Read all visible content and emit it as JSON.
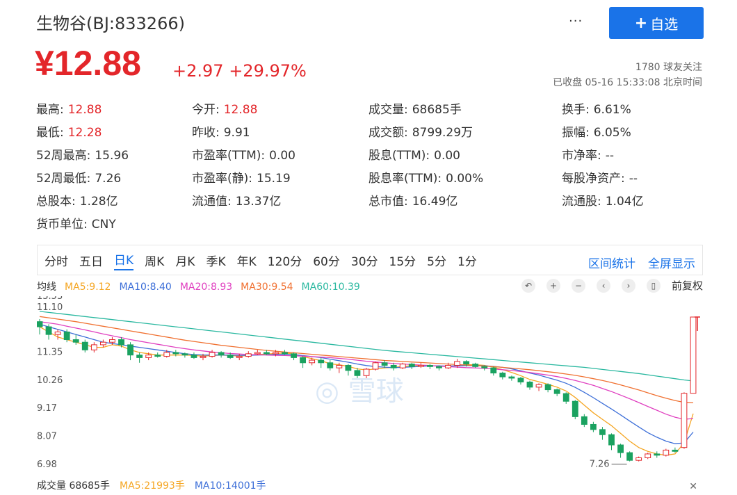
{
  "header": {
    "title": "生物谷(BJ:833266)",
    "more_label": "···",
    "add_label": "自选",
    "add_icon": "plus-icon"
  },
  "price": {
    "current": "¥12.88",
    "change": "+2.97",
    "change_pct": "+29.97%",
    "followers": "1780 球友关注",
    "status": "已收盘 05-16 15:33:08 北京时间"
  },
  "quote": [
    [
      {
        "label": "最高:",
        "value": "12.88",
        "tone": "red"
      },
      {
        "label": "今开:",
        "value": "12.88",
        "tone": "red"
      },
      {
        "label": "成交量:",
        "value": "68685手",
        "tone": ""
      },
      {
        "label": "换手:",
        "value": "6.61%",
        "tone": ""
      }
    ],
    [
      {
        "label": "最低:",
        "value": "12.28",
        "tone": "red"
      },
      {
        "label": "昨收:",
        "value": "9.91",
        "tone": ""
      },
      {
        "label": "成交额:",
        "value": "8799.29万",
        "tone": ""
      },
      {
        "label": "振幅:",
        "value": "6.05%",
        "tone": ""
      }
    ],
    [
      {
        "label": "52周最高:",
        "value": "15.96",
        "tone": ""
      },
      {
        "label": "市盈率(TTM):",
        "value": "0.00",
        "tone": ""
      },
      {
        "label": "股息(TTM):",
        "value": "0.00",
        "tone": ""
      },
      {
        "label": "市净率:",
        "value": "--",
        "tone": ""
      }
    ],
    [
      {
        "label": "52周最低:",
        "value": "7.26",
        "tone": ""
      },
      {
        "label": "市盈率(静):",
        "value": "15.19",
        "tone": ""
      },
      {
        "label": "股息率(TTM):",
        "value": "0.00%",
        "tone": ""
      },
      {
        "label": "每股净资产:",
        "value": "--",
        "tone": ""
      }
    ],
    [
      {
        "label": "总股本:",
        "value": "1.28亿",
        "tone": ""
      },
      {
        "label": "流通值:",
        "value": "13.37亿",
        "tone": ""
      },
      {
        "label": "总市值:",
        "value": "16.49亿",
        "tone": ""
      },
      {
        "label": "流通股:",
        "value": "1.04亿",
        "tone": ""
      }
    ],
    [
      {
        "label": "货币单位:",
        "value": "CNY",
        "tone": ""
      }
    ]
  ],
  "tabs": [
    "分时",
    "五日",
    "日K",
    "周K",
    "月K",
    "季K",
    "年K",
    "120分",
    "60分",
    "30分",
    "15分",
    "5分",
    "1分"
  ],
  "active_tab": "日K",
  "tools": [
    "区间统计",
    "全屏显示"
  ],
  "ma_legend": [
    {
      "text": "均线",
      "color": "#333333"
    },
    {
      "text": "MA5:9.12",
      "color": "#f5a623"
    },
    {
      "text": "MA10:8.40",
      "color": "#3d6fd8"
    },
    {
      "text": "MA20:8.93",
      "color": "#e040c0"
    },
    {
      "text": "MA30:9.54",
      "color": "#f07030"
    },
    {
      "text": "MA60:10.39",
      "color": "#2ab8a0"
    }
  ],
  "chart_controls": [
    "undo-icon",
    "zoom-in-icon",
    "zoom-out-icon",
    "left-icon",
    "right-icon",
    "candle-icon"
  ],
  "fq_label": "前复权",
  "volume_legend": [
    {
      "text": "成交量 68685手",
      "color": "#333333"
    },
    {
      "text": "MA5:21993手",
      "color": "#f5a623"
    },
    {
      "text": "MA10:14001手",
      "color": "#3d6fd8"
    }
  ],
  "watermark": "雪球",
  "colors": {
    "up": "#e3262a",
    "down": "#1aa260",
    "accent": "#1a73e8"
  },
  "chart_data": {
    "type": "candlestick",
    "y_ticks": [
      "13.53",
      "11.10",
      "11.35",
      "10.26",
      "9.17",
      "8.07",
      "6.98"
    ],
    "y_range": [
      6.98,
      13.53
    ],
    "min_label": "7.26",
    "candles": [
      [
        12.7,
        12.5,
        12.8,
        12.2
      ],
      [
        12.5,
        12.2,
        12.6,
        12.0
      ],
      [
        12.2,
        12.3,
        12.4,
        12.0
      ],
      [
        12.3,
        12.0,
        12.4,
        11.9
      ],
      [
        12.0,
        11.9,
        12.2,
        11.8
      ],
      [
        11.9,
        11.6,
        12.0,
        11.5
      ],
      [
        11.6,
        11.8,
        11.9,
        11.5
      ],
      [
        11.8,
        11.9,
        12.0,
        11.7
      ],
      [
        11.9,
        12.0,
        12.1,
        11.8
      ],
      [
        12.0,
        11.8,
        12.1,
        11.7
      ],
      [
        11.8,
        11.4,
        11.9,
        11.2
      ],
      [
        11.4,
        11.3,
        11.5,
        11.1
      ],
      [
        11.3,
        11.4,
        11.5,
        11.2
      ],
      [
        11.4,
        11.35,
        11.5,
        11.3
      ],
      [
        11.35,
        11.5,
        11.6,
        11.3
      ],
      [
        11.5,
        11.45,
        11.6,
        11.35
      ],
      [
        11.45,
        11.4,
        11.5,
        11.3
      ],
      [
        11.4,
        11.3,
        11.5,
        11.25
      ],
      [
        11.3,
        11.35,
        11.45,
        11.2
      ],
      [
        11.35,
        11.5,
        11.6,
        11.3
      ],
      [
        11.5,
        11.4,
        11.55,
        11.3
      ],
      [
        11.4,
        11.3,
        11.5,
        11.25
      ],
      [
        11.3,
        11.35,
        11.45,
        11.2
      ],
      [
        11.35,
        11.45,
        11.55,
        11.3
      ],
      [
        11.45,
        11.5,
        11.6,
        11.4
      ],
      [
        11.5,
        11.45,
        11.6,
        11.4
      ],
      [
        11.45,
        11.5,
        11.6,
        11.35
      ],
      [
        11.5,
        11.45,
        11.6,
        11.4
      ],
      [
        11.45,
        11.3,
        11.5,
        11.2
      ],
      [
        11.3,
        11.1,
        11.35,
        10.9
      ],
      [
        11.1,
        11.2,
        11.3,
        11.0
      ],
      [
        11.2,
        11.1,
        11.3,
        10.9
      ],
      [
        11.1,
        10.9,
        11.2,
        10.8
      ],
      [
        10.9,
        11.0,
        11.1,
        10.7
      ],
      [
        11.0,
        10.8,
        11.05,
        10.6
      ],
      [
        10.8,
        10.6,
        10.9,
        10.5
      ],
      [
        10.6,
        10.85,
        10.9,
        10.5
      ],
      [
        10.85,
        11.1,
        11.15,
        10.8
      ],
      [
        11.1,
        11.0,
        11.2,
        10.9
      ],
      [
        11.0,
        10.9,
        11.1,
        10.8
      ],
      [
        10.9,
        11.05,
        11.1,
        10.85
      ],
      [
        11.05,
        10.95,
        11.1,
        10.85
      ],
      [
        10.95,
        11.0,
        11.1,
        10.9
      ],
      [
        11.0,
        10.95,
        11.05,
        10.85
      ],
      [
        10.95,
        10.9,
        11.0,
        10.8
      ],
      [
        10.9,
        11.0,
        11.1,
        10.85
      ],
      [
        11.0,
        11.15,
        11.25,
        10.9
      ],
      [
        11.15,
        11.05,
        11.2,
        10.95
      ],
      [
        11.05,
        10.95,
        11.1,
        10.9
      ],
      [
        10.95,
        10.9,
        11.0,
        10.8
      ],
      [
        10.9,
        10.7,
        10.95,
        10.6
      ],
      [
        10.7,
        10.55,
        10.75,
        10.45
      ],
      [
        10.55,
        10.5,
        10.6,
        10.4
      ],
      [
        10.5,
        10.35,
        10.55,
        10.25
      ],
      [
        10.35,
        10.15,
        10.4,
        10.05
      ],
      [
        10.15,
        10.25,
        10.3,
        10.0
      ],
      [
        10.25,
        10.05,
        10.3,
        9.95
      ],
      [
        10.05,
        9.9,
        10.1,
        9.8
      ],
      [
        9.9,
        9.6,
        9.95,
        9.5
      ],
      [
        9.6,
        9.0,
        9.65,
        8.9
      ],
      [
        9.0,
        8.7,
        9.1,
        8.6
      ],
      [
        8.7,
        8.5,
        8.8,
        8.4
      ],
      [
        8.5,
        8.3,
        8.6,
        8.1
      ],
      [
        8.3,
        7.9,
        8.35,
        7.7
      ],
      [
        7.9,
        7.6,
        7.95,
        7.4
      ],
      [
        7.6,
        7.3,
        7.65,
        7.26
      ],
      [
        7.3,
        7.4,
        7.45,
        7.26
      ],
      [
        7.4,
        7.55,
        7.6,
        7.35
      ],
      [
        7.55,
        7.5,
        7.65,
        7.4
      ],
      [
        7.5,
        7.7,
        7.75,
        7.45
      ],
      [
        7.7,
        7.65,
        7.8,
        7.6
      ],
      [
        7.8,
        9.91,
        9.95,
        7.75
      ],
      [
        9.91,
        12.88,
        12.88,
        12.28
      ]
    ],
    "ma": {
      "MA5": [
        12.5,
        12.3,
        12.1,
        12.0,
        11.9,
        11.8,
        11.7,
        11.7,
        11.8,
        11.75,
        11.6,
        11.5,
        11.45,
        11.4,
        11.4,
        11.4,
        11.4,
        11.38,
        11.36,
        11.38,
        11.4,
        11.38,
        11.36,
        11.38,
        11.42,
        11.44,
        11.46,
        11.48,
        11.44,
        11.34,
        11.26,
        11.18,
        11.06,
        11.02,
        10.96,
        10.86,
        10.82,
        10.86,
        10.9,
        10.92,
        10.96,
        10.98,
        11.0,
        11.0,
        10.96,
        10.96,
        11.0,
        11.02,
        11.02,
        11.0,
        10.93,
        10.83,
        10.72,
        10.6,
        10.45,
        10.36,
        10.26,
        10.15,
        10.0,
        9.75,
        9.45,
        9.15,
        8.9,
        8.65,
        8.35,
        8.05,
        7.8,
        7.65,
        7.55,
        7.5,
        7.55,
        7.98,
        9.12
      ],
      "MA10": [
        12.6,
        12.5,
        12.4,
        12.3,
        12.2,
        12.1,
        12.0,
        11.9,
        11.85,
        11.8,
        11.75,
        11.7,
        11.65,
        11.6,
        11.55,
        11.5,
        11.45,
        11.42,
        11.4,
        11.4,
        11.4,
        11.4,
        11.39,
        11.39,
        11.4,
        11.41,
        11.42,
        11.43,
        11.42,
        11.38,
        11.34,
        11.3,
        11.24,
        11.18,
        11.12,
        11.05,
        10.99,
        10.95,
        10.93,
        10.91,
        10.92,
        10.94,
        10.96,
        10.98,
        10.98,
        10.97,
        10.98,
        10.99,
        10.99,
        10.98,
        10.96,
        10.92,
        10.86,
        10.79,
        10.7,
        10.62,
        10.52,
        10.42,
        10.3,
        10.14,
        9.95,
        9.74,
        9.52,
        9.3,
        9.07,
        8.83,
        8.6,
        8.38,
        8.2,
        8.05,
        7.95,
        7.98,
        8.4
      ],
      "MA20": [
        12.7,
        12.65,
        12.6,
        12.52,
        12.45,
        12.38,
        12.3,
        12.22,
        12.15,
        12.08,
        12.0,
        11.94,
        11.88,
        11.82,
        11.76,
        11.7,
        11.65,
        11.6,
        11.56,
        11.52,
        11.49,
        11.46,
        11.44,
        11.42,
        11.41,
        11.4,
        11.39,
        11.38,
        11.37,
        11.36,
        11.34,
        11.32,
        11.3,
        11.27,
        11.24,
        11.2,
        11.16,
        11.13,
        11.1,
        11.07,
        11.05,
        11.03,
        11.01,
        10.99,
        10.97,
        10.95,
        10.93,
        10.91,
        10.9,
        10.88,
        10.86,
        10.83,
        10.8,
        10.76,
        10.72,
        10.67,
        10.62,
        10.56,
        10.49,
        10.41,
        10.32,
        10.22,
        10.1,
        9.98,
        9.84,
        9.7,
        9.55,
        9.4,
        9.25,
        9.1,
        8.98,
        8.9,
        8.93
      ],
      "MA30": [
        12.9,
        12.85,
        12.8,
        12.75,
        12.7,
        12.64,
        12.58,
        12.52,
        12.46,
        12.4,
        12.34,
        12.28,
        12.22,
        12.16,
        12.1,
        12.04,
        11.98,
        11.93,
        11.88,
        11.83,
        11.78,
        11.74,
        11.7,
        11.66,
        11.62,
        11.58,
        11.55,
        11.52,
        11.49,
        11.46,
        11.43,
        11.4,
        11.37,
        11.34,
        11.31,
        11.28,
        11.25,
        11.22,
        11.19,
        11.17,
        11.15,
        11.13,
        11.11,
        11.09,
        11.07,
        11.05,
        11.03,
        11.01,
        10.99,
        10.97,
        10.95,
        10.92,
        10.89,
        10.86,
        10.83,
        10.79,
        10.75,
        10.71,
        10.66,
        10.61,
        10.55,
        10.48,
        10.41,
        10.33,
        10.24,
        10.14,
        10.04,
        9.93,
        9.82,
        9.72,
        9.63,
        9.56,
        9.54
      ],
      "MA60": [
        13.1,
        13.06,
        13.02,
        12.98,
        12.94,
        12.9,
        12.86,
        12.82,
        12.78,
        12.74,
        12.7,
        12.66,
        12.62,
        12.58,
        12.54,
        12.5,
        12.46,
        12.42,
        12.38,
        12.34,
        12.3,
        12.26,
        12.22,
        12.18,
        12.14,
        12.1,
        12.06,
        12.02,
        11.98,
        11.94,
        11.9,
        11.86,
        11.82,
        11.78,
        11.74,
        11.7,
        11.66,
        11.62,
        11.58,
        11.55,
        11.52,
        11.49,
        11.46,
        11.43,
        11.4,
        11.37,
        11.34,
        11.31,
        11.28,
        11.25,
        11.22,
        11.19,
        11.16,
        11.13,
        11.1,
        11.07,
        11.04,
        11.01,
        10.98,
        10.95,
        10.92,
        10.88,
        10.84,
        10.8,
        10.76,
        10.72,
        10.68,
        10.63,
        10.58,
        10.53,
        10.48,
        10.43,
        10.39
      ]
    }
  }
}
